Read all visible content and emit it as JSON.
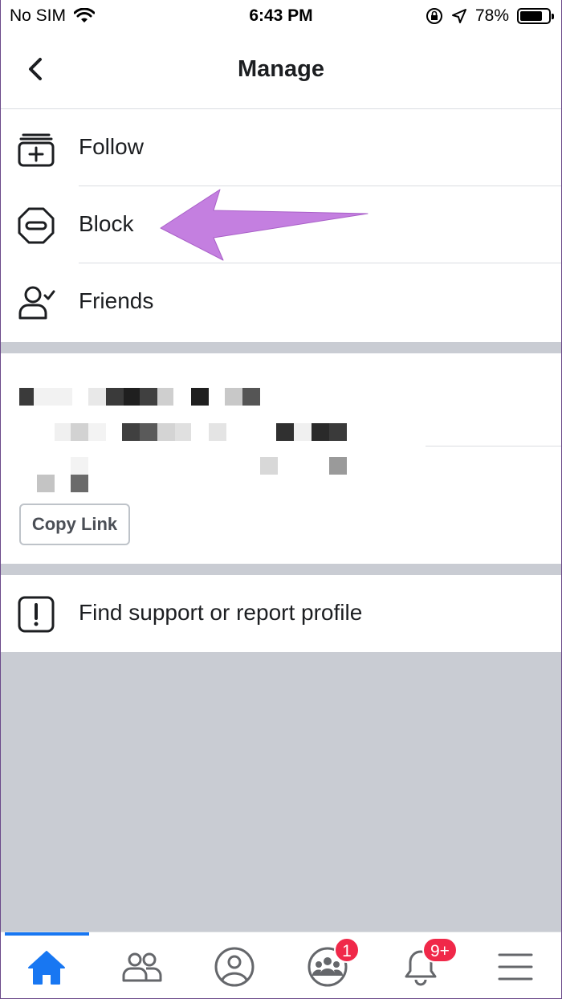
{
  "status_bar": {
    "carrier": "No SIM",
    "time": "6:43 PM",
    "battery_percent": "78%",
    "battery_level": 0.78
  },
  "header": {
    "title": "Manage",
    "back_icon": "chevron-left-icon"
  },
  "manage_items": [
    {
      "label": "Follow",
      "icon": "follow-stack-plus-icon"
    },
    {
      "label": "Block",
      "icon": "block-octagon-icon"
    },
    {
      "label": "Friends",
      "icon": "friends-check-icon"
    }
  ],
  "link_section": {
    "copy_link_label": "Copy Link"
  },
  "support": {
    "label": "Find support or report profile",
    "icon": "exclamation-box-icon"
  },
  "tab_bar": {
    "tabs": [
      {
        "name": "home",
        "icon": "home-icon",
        "active": true
      },
      {
        "name": "friends",
        "icon": "friends-icon"
      },
      {
        "name": "profile",
        "icon": "profile-icon"
      },
      {
        "name": "groups",
        "icon": "groups-icon",
        "badge": "1"
      },
      {
        "name": "notifications",
        "icon": "bell-icon",
        "badge": "9+"
      },
      {
        "name": "menu",
        "icon": "menu-icon"
      }
    ]
  },
  "colors": {
    "accent": "#1877f2",
    "badge": "#f02849",
    "annotation_arrow": "#c47fe0",
    "separator": "#c9ccd3"
  }
}
